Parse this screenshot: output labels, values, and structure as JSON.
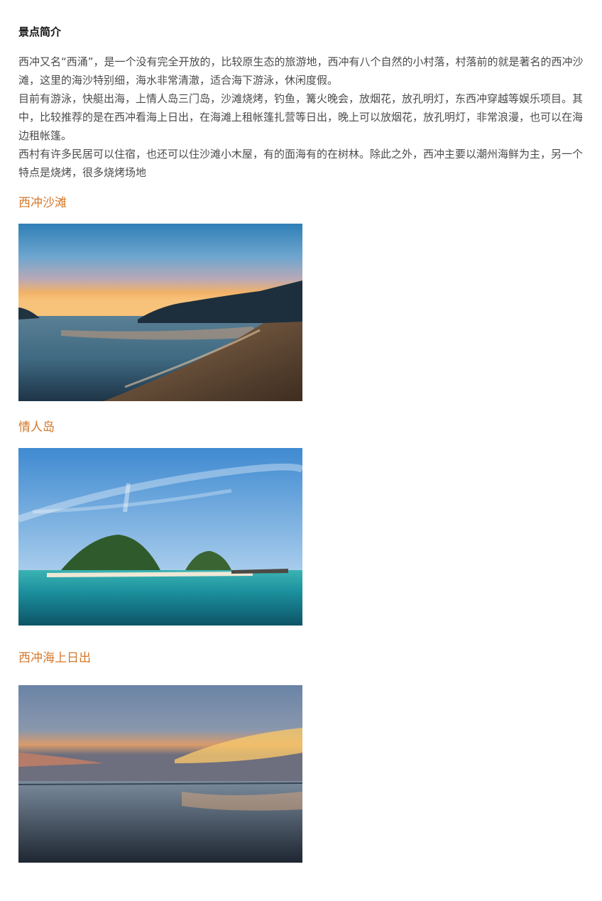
{
  "heading": "景点简介",
  "intro": [
    "西冲又名“西涌”，是一个没有完全开放的，比较原生态的旅游地，西冲有八个自然的小村落，村落前的就是著名的西冲沙滩，这里的海沙特别细，海水非常清澈，适合海下游泳，休闲度假。",
    "目前有游泳，快艇出海，上情人岛三门岛，沙滩烧烤，钓鱼，篝火晚会，放烟花，放孔明灯，东西冲穿越等娱乐项目。其中，比较推荐的是在西冲看海上日出，在海滩上租帐篷扎营等日出，晚上可以放烟花，放孔明灯，非常浪漫，也可以在海边租帐篷。",
    "西村有许多民居可以住宿，也还可以住沙滩小木屋，有的面海有的在树林。除此之外，西冲主要以潮州海鲜为主，另一个特点是烧烤，很多烧烤场地"
  ],
  "sections": [
    {
      "title": "西冲沙滩"
    },
    {
      "title": "情人岛"
    },
    {
      "title": "西冲海上日出"
    }
  ],
  "colors": {
    "section_title": "#d4782b",
    "body_text": "#4b4b4b",
    "heading": "#111111"
  }
}
